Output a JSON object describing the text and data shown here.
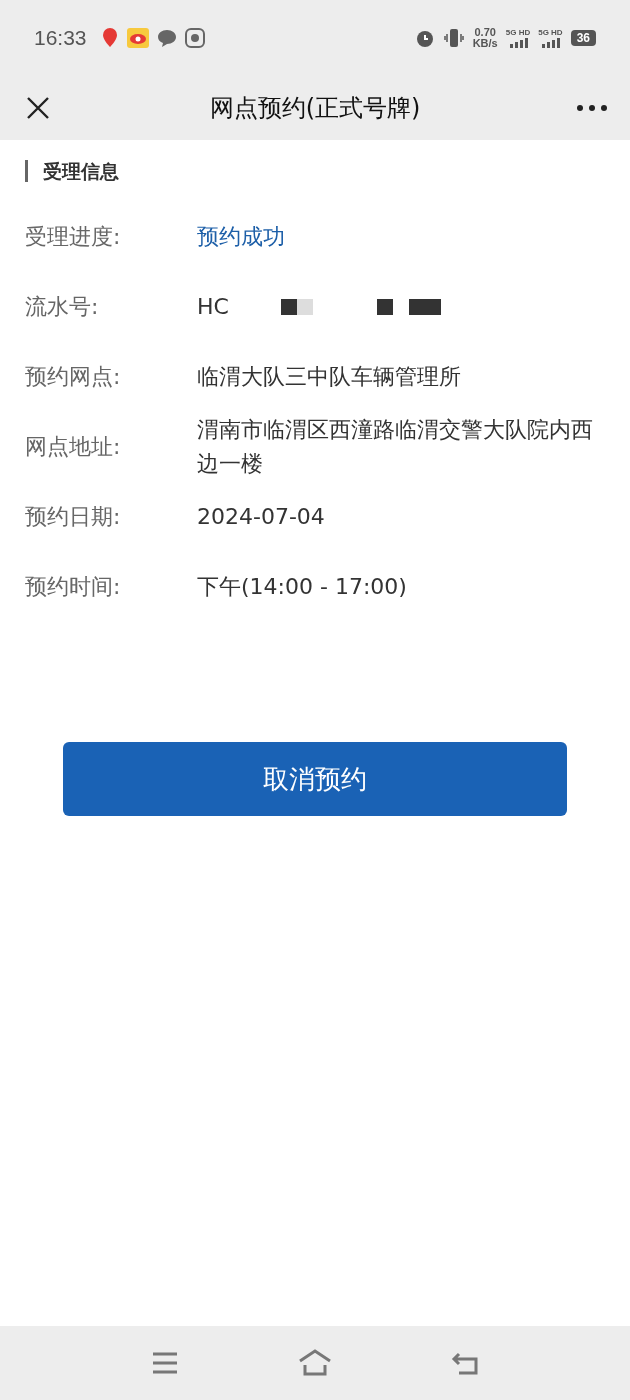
{
  "status_bar": {
    "time": "16:33",
    "speed": "0.70",
    "speed_unit": "KB/s",
    "sims": [
      "5G HD",
      "5G HD"
    ],
    "battery": "36"
  },
  "nav": {
    "title": "网点预约(正式号牌)"
  },
  "section": {
    "title": "受理信息"
  },
  "fields": [
    {
      "label": "受理进度:",
      "value": "预约成功",
      "kind": "status"
    },
    {
      "label": "流水号:",
      "value": "HC",
      "kind": "redacted"
    },
    {
      "label": "预约网点:",
      "value": "临渭大队三中队车辆管理所",
      "kind": "text"
    },
    {
      "label": "网点地址:",
      "value": "渭南市临渭区西潼路临渭交警大队院内西边一楼",
      "kind": "text"
    },
    {
      "label": "预约日期:",
      "value": "2024-07-04",
      "kind": "text"
    },
    {
      "label": "预约时间:",
      "value": "下午(14:00 - 17:00)",
      "kind": "text"
    }
  ],
  "button": {
    "label": "取消预约"
  }
}
